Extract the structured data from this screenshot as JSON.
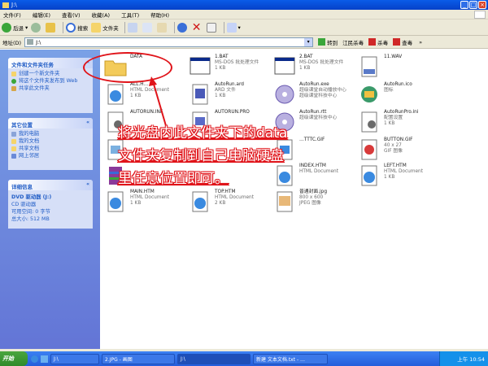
{
  "window": {
    "title": "J:\\"
  },
  "menu": [
    "文件(F)",
    "编辑(E)",
    "查看(V)",
    "收藏(A)",
    "工具(T)",
    "帮助(H)"
  ],
  "toolbar": {
    "back": "后退",
    "search": "搜索",
    "folders": "文件夹"
  },
  "address": {
    "label": "地址(D)",
    "value": "J:\\",
    "go": "转到",
    "extra1": "江民杀毒",
    "extra2": "杀毒",
    "extra3": "查毒"
  },
  "tasks_panel": {
    "title": "文件和文件夹任务",
    "items": [
      "创建一个新文件夹",
      "将这个文件夹发布到 Web",
      "共享此文件夹"
    ]
  },
  "places_panel": {
    "title": "其它位置",
    "items": [
      "我的电脑",
      "我的文档",
      "共享文档",
      "网上邻居"
    ]
  },
  "details_panel": {
    "title": "详细信息",
    "name": "DVD 驱动器 (J:)",
    "type": "CD 驱动器",
    "free": "可用空间: 0 字节",
    "total": "总大小: 512 MB"
  },
  "files": [
    {
      "name": "DATA",
      "line2": "",
      "line3": "",
      "icon": "folder"
    },
    {
      "name": "1.BAT",
      "line2": "MS-DOS 批处理文件",
      "line3": "1 KB",
      "icon": "bat"
    },
    {
      "name": "2.BAT",
      "line2": "MS-DOS 批处理文件",
      "line3": "1 KB",
      "icon": "bat"
    },
    {
      "name": "11.WAV",
      "line2": "",
      "line3": "",
      "icon": "wav"
    },
    {
      "name": "ALL.H…",
      "line2": "HTML Document",
      "line3": "1 KB",
      "icon": "html"
    },
    {
      "name": "AutoRun.ard",
      "line2": "ARD 文件",
      "line3": "1 KB",
      "icon": "ard"
    },
    {
      "name": "AutoRun.exe",
      "line2": "超级课堂自动播放中心",
      "line3": "超级课堂科技中心",
      "icon": "exe"
    },
    {
      "name": "AutoRun.ico",
      "line2": "图标",
      "line3": "",
      "icon": "ico"
    },
    {
      "name": "AUTORUN.INF",
      "line2": "",
      "line3": "",
      "icon": "inf"
    },
    {
      "name": "AUTORUN.PRO",
      "line2": "",
      "line3": "",
      "icon": "pro"
    },
    {
      "name": "AutoRun.rtt",
      "line2": "超级课堂科技中心",
      "line3": "",
      "icon": "exe"
    },
    {
      "name": "AutoRunPro.ini",
      "line2": "配置设置",
      "line3": "1 KB",
      "icon": "ini"
    },
    {
      "name": "",
      "line2": "",
      "line3": "",
      "icon": "bmp"
    },
    {
      "name": "…TTTC.GIF",
      "line2": "",
      "line3": "",
      "icon": "gif"
    },
    {
      "name": "BUTTON.GIF",
      "line2": "40 x 27",
      "line3": "GIF 图像",
      "icon": "gif"
    },
    {
      "name": "",
      "line2": "",
      "line3": "",
      "icon": "rar"
    },
    {
      "name": "INDEX.HTM",
      "line2": "HTML Document",
      "line3": "",
      "icon": "html"
    },
    {
      "name": "LEFT.HTM",
      "line2": "HTML Document",
      "line3": "1 KB",
      "icon": "html"
    },
    {
      "name": "MAIN.HTM",
      "line2": "HTML Document",
      "line3": "1 KB",
      "icon": "html"
    },
    {
      "name": "TOP.HTM",
      "line2": "HTML Document",
      "line3": "2 KB",
      "icon": "html"
    },
    {
      "name": "普通封面.jpg",
      "line2": "800 x 600",
      "line3": "JPEG 图像",
      "icon": "jpg"
    }
  ],
  "annotation": {
    "line1": "将光盘内此文件夹下的data",
    "line2": "文件夹复制到自己电脑硬盘",
    "line3": "里任意位置即可。"
  },
  "taskbar": {
    "start": "开始",
    "t1": "J:\\",
    "t2": "2.JPG - 画图",
    "t3": "J:\\",
    "t4": "新建 文本文档.txt - …",
    "clock": "上午 10:54"
  },
  "colors": {
    "accent": "#0a5ce8",
    "annotation": "#e0141a"
  }
}
